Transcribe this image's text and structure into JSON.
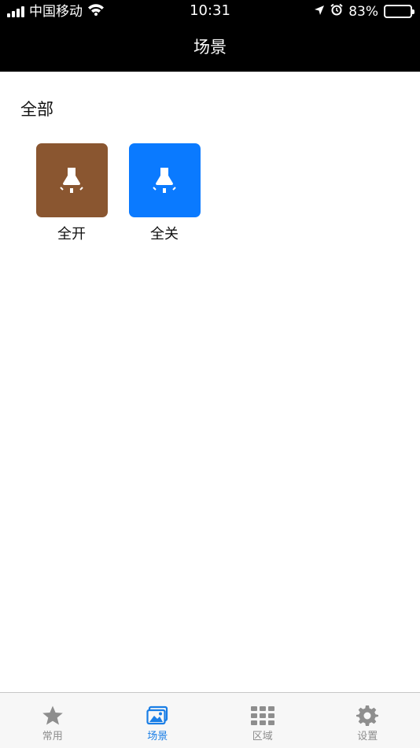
{
  "status_bar": {
    "carrier": "中国移动",
    "time": "10:31",
    "battery_percent": "83%",
    "battery_level": 0.83,
    "icons": [
      "signal-icon",
      "wifi-icon",
      "location-arrow-icon",
      "alarm-icon",
      "battery-icon"
    ]
  },
  "header": {
    "title": "场景"
  },
  "section": {
    "title": "全部"
  },
  "scenes": [
    {
      "label": "全开",
      "color": "#8a5630",
      "icon": "lamp-on-icon"
    },
    {
      "label": "全关",
      "color": "#0a7aff",
      "icon": "lamp-off-icon"
    }
  ],
  "tabbar": {
    "active_color": "#1a7ee6",
    "inactive_color": "#8e8e8e",
    "items": [
      {
        "label": "常用",
        "icon": "star-icon",
        "active": false
      },
      {
        "label": "场景",
        "icon": "picture-icon",
        "active": true
      },
      {
        "label": "区域",
        "icon": "grid-icon",
        "active": false
      },
      {
        "label": "设置",
        "icon": "gear-icon",
        "active": false
      }
    ]
  }
}
